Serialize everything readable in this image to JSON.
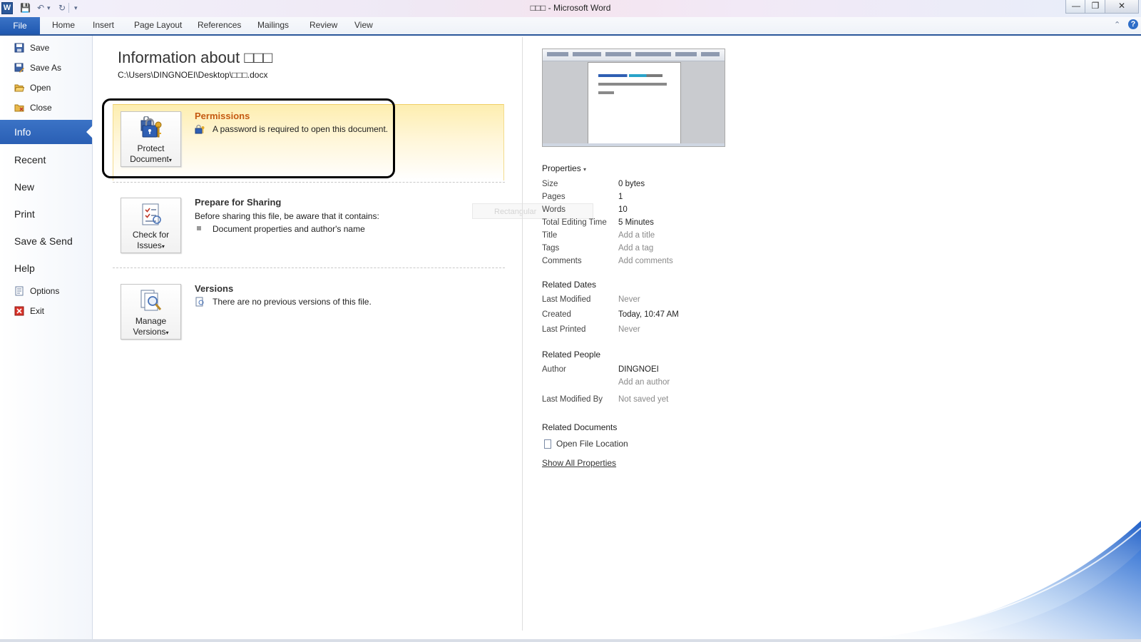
{
  "window": {
    "title": "□□□ - Microsoft Word",
    "app_icon": "W",
    "minimize_icon": "—",
    "restore_icon": "❐",
    "close_icon": "✕"
  },
  "quick_access": {
    "save_icon": "💾",
    "undo_icon": "↶",
    "undo_dropdown": "▾",
    "redo_icon": "↻",
    "customize_icon": "▾"
  },
  "ribbon": {
    "file_tab": "File",
    "tabs": [
      "Home",
      "Insert",
      "Page Layout",
      "References",
      "Mailings",
      "Review",
      "View"
    ],
    "minimize_ribbon_icon": "⌃",
    "help_icon": "?"
  },
  "nav": {
    "small_top": [
      {
        "label": "Save",
        "icon": "save-icon"
      },
      {
        "label": "Save As",
        "icon": "save-as-icon"
      },
      {
        "label": "Open",
        "icon": "open-folder-icon"
      },
      {
        "label": "Close",
        "icon": "close-folder-icon"
      }
    ],
    "big": [
      "Info",
      "Recent",
      "New",
      "Print",
      "Save & Send",
      "Help"
    ],
    "active": "Info",
    "small_bottom": [
      {
        "label": "Options",
        "icon": "options-icon"
      },
      {
        "label": "Exit",
        "icon": "exit-icon"
      }
    ]
  },
  "info": {
    "title": "Information about □□□",
    "path": "C:\\Users\\DINGNOEI\\Desktop\\□□□.docx",
    "permissions": {
      "button_line1": "Protect",
      "button_line2": "Document",
      "title": "Permissions",
      "text": "A password is required to open this document."
    },
    "sharing": {
      "button_line1": "Check for",
      "button_line2": "Issues",
      "title": "Prepare for Sharing",
      "text": "Before sharing this file, be aware that it contains:",
      "bullet": "Document properties and author's name"
    },
    "versions": {
      "button_line1": "Manage",
      "button_line2": "Versions",
      "title": "Versions",
      "text": "There are no previous versions of this file."
    },
    "dropdown_glyph": "▾",
    "ghost_tooltip": "Rectangular"
  },
  "properties": {
    "header": "Properties",
    "dropdown_glyph": "▾",
    "rows": [
      {
        "key": "Size",
        "value": "0 bytes",
        "muted": false
      },
      {
        "key": "Pages",
        "value": "1",
        "muted": false
      },
      {
        "key": "Words",
        "value": "10",
        "muted": false
      },
      {
        "key": "Total Editing Time",
        "value": "5 Minutes",
        "muted": false
      },
      {
        "key": "Title",
        "value": "Add a title",
        "muted": true
      },
      {
        "key": "Tags",
        "value": "Add a tag",
        "muted": true
      },
      {
        "key": "Comments",
        "value": "Add comments",
        "muted": true
      }
    ],
    "related_dates": {
      "header": "Related Dates",
      "rows": [
        {
          "key": "Last Modified",
          "value": "Never",
          "muted": true
        },
        {
          "key": "Created",
          "value": "Today, 10:47 AM",
          "muted": false
        },
        {
          "key": "Last Printed",
          "value": "Never",
          "muted": true
        }
      ]
    },
    "related_people": {
      "header": "Related People",
      "author_key": "Author",
      "author_value": "DINGNOEI",
      "add_author": "Add an author",
      "last_modified_by_key": "Last Modified By",
      "last_modified_by_value": "Not saved yet"
    },
    "related_documents": {
      "header": "Related Documents",
      "open_location": "Open File Location"
    },
    "show_all": "Show All Properties"
  },
  "colors": {
    "accent": "#2b579a",
    "file_tab": "#2a5fb4",
    "permissions_title": "#c55a11",
    "permissions_bg": "#fdeeb0"
  }
}
